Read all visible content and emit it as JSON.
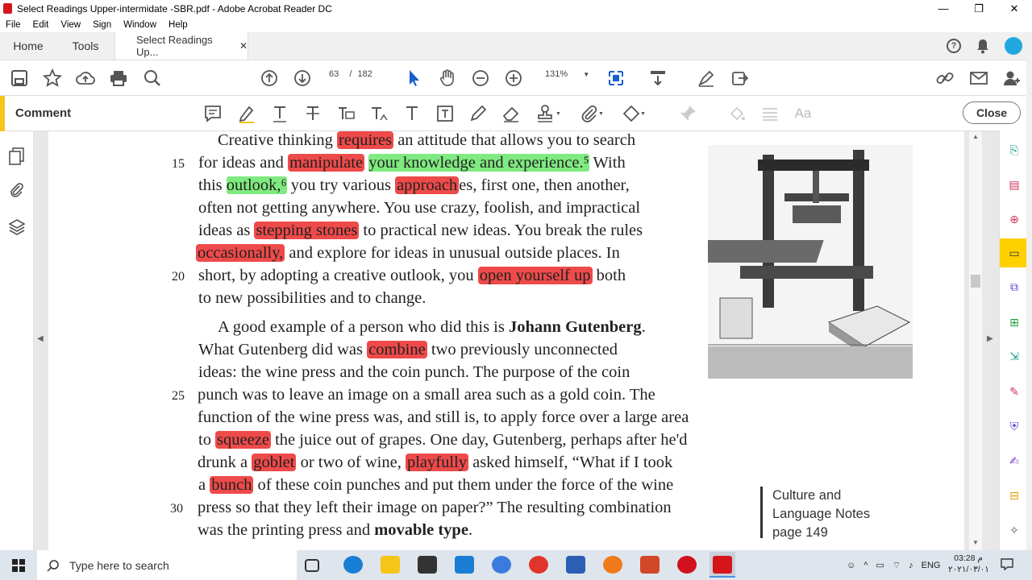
{
  "window": {
    "title": "Select Readings Upper-intermidate -SBR.pdf - Adobe Acrobat Reader DC",
    "minimize": "—",
    "restore": "❐",
    "close": "✕"
  },
  "menu": [
    "File",
    "Edit",
    "View",
    "Sign",
    "Window",
    "Help"
  ],
  "tabs": {
    "home": "Home",
    "tools": "Tools",
    "doc": "Select Readings Up...",
    "doc_close": "✕",
    "help": "?"
  },
  "toolbar": {
    "page_current": "63",
    "page_sep": "/",
    "page_total": "182",
    "zoom": "131%"
  },
  "comment_bar": {
    "label": "Comment",
    "close": "Close",
    "font_tool": "Aa"
  },
  "document": {
    "line_numbers": [
      "15",
      "20",
      "25",
      "30"
    ],
    "lines": [
      [
        "Creative thinking ",
        {
          "hl": "red",
          "t": "requires"
        },
        " an attitude that allows you to search"
      ],
      [
        "for ideas and ",
        {
          "hl": "red",
          "t": "manipulate"
        },
        " ",
        {
          "hl": "green",
          "t": "your knowledge and experience.⁵"
        },
        " With"
      ],
      [
        "this ",
        {
          "hl": "green",
          "t": "outlook,⁶"
        },
        " you try various ",
        {
          "hl": "red",
          "t": "approach"
        },
        "es, first one, then another,"
      ],
      [
        "often not getting anywhere. You use crazy, foolish, and impractical"
      ],
      [
        "ideas as ",
        {
          "hl": "red",
          "t": "stepping stones"
        },
        " to practical new ideas. You break the rules"
      ],
      [
        {
          "hl": "red",
          "t": "occasionally,"
        },
        " and explore for ideas in unusual outside places. In"
      ],
      [
        "short, by adopting a creative outlook, you ",
        {
          "hl": "red",
          "t": "open yourself up"
        },
        " both"
      ],
      [
        "to new possibilities and to change."
      ],
      [
        "A good example of a person who did this is ",
        {
          "b": true,
          "t": "Johann Gutenberg"
        },
        "."
      ],
      [
        "What Gutenberg did was ",
        {
          "hl": "red",
          "t": "combine"
        },
        " two previously unconnected"
      ],
      [
        "ideas: the wine press and the coin punch. The purpose of the coin"
      ],
      [
        "punch was to leave an image on a small area such as a gold coin. The"
      ],
      [
        "function of the wine press was, and still is, to apply force over a large area"
      ],
      [
        "to ",
        {
          "hl": "red",
          "t": "squeeze"
        },
        " the juice out of grapes. One day, Gutenberg, perhaps after he'd"
      ],
      [
        "drunk a ",
        {
          "hl": "red",
          "t": "goblet"
        },
        " or two of wine, ",
        {
          "hl": "red",
          "t": "playfully"
        },
        " asked himself, “What if I took"
      ],
      [
        "a ",
        {
          "hl": "red",
          "t": "bunch"
        },
        " of these coin punches and put them under the force of the wine"
      ],
      [
        "press so that they left their image on paper?” The resulting combination"
      ],
      [
        "was the printing press and ",
        {
          "b": true,
          "t": "movable type"
        },
        "."
      ]
    ],
    "culture_note": [
      "Culture and",
      "Language Notes",
      "page 149"
    ]
  },
  "taskbar": {
    "search_placeholder": "Type here to search",
    "lang": "ENG",
    "time": "03:28 م",
    "date": "٢٠٢١/٠٣/٠١"
  },
  "colors": {
    "highlight_red": "#ef4a4a",
    "highlight_green": "#7fea7f",
    "accent_yellow": "#f5c518"
  }
}
